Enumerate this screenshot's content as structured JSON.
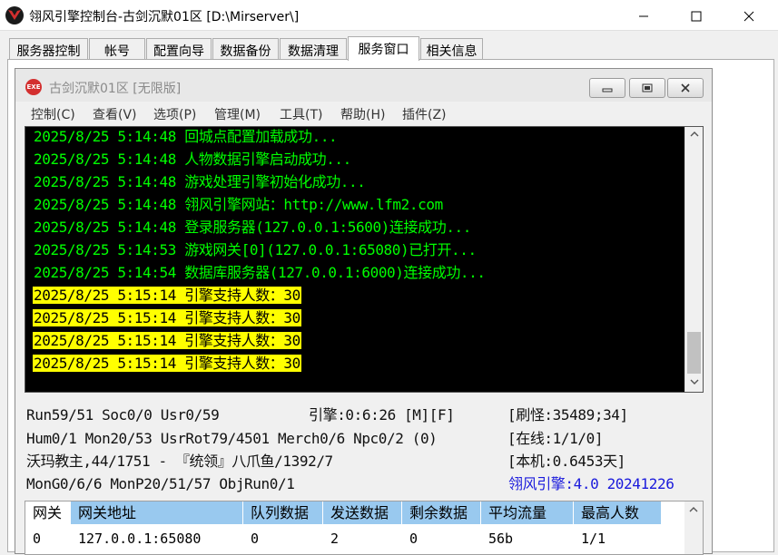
{
  "window": {
    "title": "翎风引擎控制台-古剑沉默01区 [D:\\Mirserver\\]"
  },
  "tabs": [
    "服务器控制",
    "帐号",
    "配置向导",
    "数据备份",
    "数据清理",
    "服务窗口",
    "相关信息"
  ],
  "active_tab": "服务窗口",
  "inner_window": {
    "icon_text": "EXE",
    "title": "古剑沉默01区 [无限版]",
    "menu": [
      "控制(C)",
      "查看(V)",
      "选项(P)",
      "管理(M)",
      "工具(T)",
      "帮助(H)",
      "插件(Z)"
    ]
  },
  "log": {
    "lines": [
      {
        "text": "2025/8/25 5:14:48 回城点配置加载成功...",
        "highlight": false
      },
      {
        "text": "2025/8/25 5:14:48 人物数据引擎启动成功...",
        "highlight": false
      },
      {
        "text": "2025/8/25 5:14:48 游戏处理引擎初始化成功...",
        "highlight": false
      },
      {
        "text": "2025/8/25 5:14:48 翎风引擎网站：http://www.lfm2.com",
        "highlight": false
      },
      {
        "text": "2025/8/25 5:14:48 登录服务器(127.0.0.1:5600)连接成功...",
        "highlight": false
      },
      {
        "text": "2025/8/25 5:14:53 游戏网关[0](127.0.0.1:65080)已打开...",
        "highlight": false
      },
      {
        "text": "2025/8/25 5:14:54 数据库服务器(127.0.0.1:6000)连接成功...",
        "highlight": false
      },
      {
        "text": "2025/8/25 5:15:14 引擎支持人数：30",
        "highlight": true
      },
      {
        "text": "2025/8/25 5:15:14 引擎支持人数：30",
        "highlight": true
      },
      {
        "text": "2025/8/25 5:15:14 引擎支持人数：30",
        "highlight": true
      },
      {
        "text": "2025/8/25 5:15:14 引擎支持人数：30",
        "highlight": true
      }
    ],
    "colors": {
      "background": "#000000",
      "text": "#00ff00",
      "highlight_bg": "#ffff00",
      "highlight_text": "#000000"
    }
  },
  "status": {
    "row1_a": "Run59/51 Soc0/0 Usr0/59",
    "row1_b": "引擎:0:6:26 [M][F]",
    "row1_c": "[刷怪:35489;34]",
    "row2_a": "Hum0/1 Mon20/53 UsrRot79/4501 Merch0/6 Npc0/2 (0)",
    "row2_c": "[在线:1/1/0]",
    "row3_a": "沃玛教主,44/1751 - 『统领』八爪鱼/1392/7",
    "row3_c": "[本机:0.6453天]",
    "row4_a": "MonG0/6/6 MonP20/51/57 ObjRun0/1",
    "row4_c": "翎风引擎:4.0 20241226",
    "version_color": "#1a1adc"
  },
  "gateway_table": {
    "headers": [
      "网关",
      "网关地址",
      "队列数据",
      "发送数据",
      "剩余数据",
      "平均流量",
      "最高人数"
    ],
    "rows": [
      [
        "0",
        "127.0.0.1:65080",
        "0",
        "2",
        "0",
        "56b",
        "1/1"
      ]
    ]
  }
}
